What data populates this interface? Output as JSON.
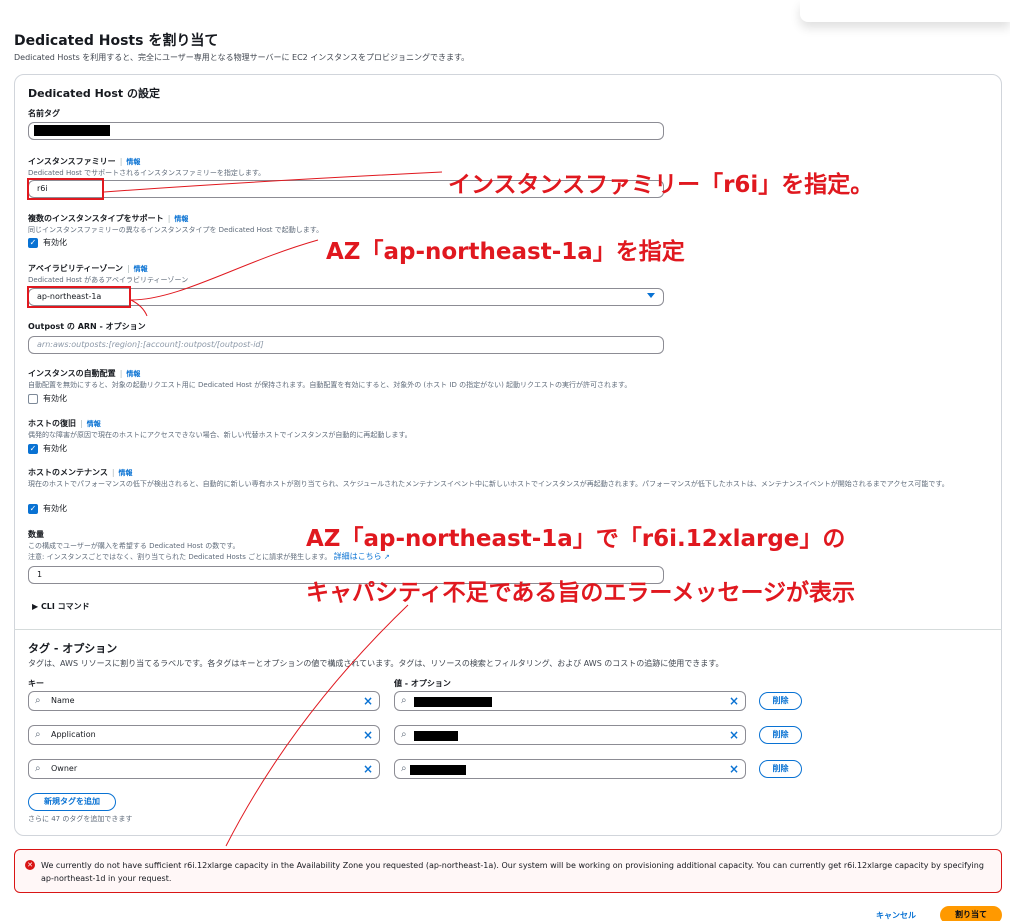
{
  "page": {
    "title": "Dedicated Hosts を割り当て",
    "description": "Dedicated Hosts を利用すると、完全にユーザー専用となる物理サーバーに EC2 インスタンスをプロビジョニングできます。"
  },
  "settings": {
    "title": "Dedicated Host の設定",
    "name_tag_label": "名前タグ",
    "info_label": "情報",
    "instance_family": {
      "label": "インスタンスファミリー",
      "desc": "Dedicated Host でサポートされるインスタンスファミリーを指定します。",
      "value": "r6i"
    },
    "multi_type": {
      "label": "複数のインスタンスタイプをサポート",
      "desc": "同じインスタンスファミリーの異なるインスタンスタイプを Dedicated Host で起動します。",
      "checkbox": "有効化",
      "checked": true
    },
    "az": {
      "label": "アベイラビリティーゾーン",
      "desc": "Dedicated Host があるアベイラビリティーゾーン",
      "value": "ap-northeast-1a"
    },
    "outpost": {
      "label": "Outpost の ARN - オプション",
      "placeholder": "arn:aws:outposts:[region]:[account]:outpost/[outpost-id]"
    },
    "auto_placement": {
      "label": "インスタンスの自動配置",
      "desc": "自動配置を無効にすると、対象の起動リクエスト用に Dedicated Host が保持されます。自動配置を有効にすると、対象外の (ホスト ID の指定がない) 起動リクエストの実行が許可されます。",
      "checkbox": "有効化",
      "checked": false
    },
    "host_recovery": {
      "label": "ホストの復旧",
      "desc": "偶発的な障害が原因で現在のホストにアクセスできない場合、新しい代替ホストでインスタンスが自動的に再起動します。",
      "checkbox": "有効化",
      "checked": true
    },
    "host_maintenance": {
      "label": "ホストのメンテナンス",
      "desc": "現在のホストでパフォーマンスの低下が検出されると、自動的に新しい専有ホストが割り当てられ、スケジュールされたメンテナンスイベント中に新しいホストでインスタンスが再起動されます。パフォーマンスが低下したホストは、メンテナンスイベントが開始されるまでアクセス可能です。",
      "checkbox": "有効化",
      "checked": true
    },
    "quantity": {
      "label": "数量",
      "desc": "この構成でユーザーが購入を希望する Dedicated Host の数です。",
      "note": "注意: インスタンスごとではなく、割り当てられた Dedicated Hosts ごとに請求が発生します。",
      "link": "詳細はこちら",
      "value": "1"
    },
    "cli": "CLI コマンド"
  },
  "tags": {
    "title": "タグ - オプション",
    "desc": "タグは、AWS リソースに割り当てるラベルです。各タグはキーとオプションの値で構成されています。タグは、リソースの検索とフィルタリング、および AWS のコストの追跡に使用できます。",
    "key_header": "キー",
    "value_header": "値 - オプション",
    "rows": [
      {
        "key": "Name",
        "remove": "削除"
      },
      {
        "key": "Application",
        "remove": "削除"
      },
      {
        "key": "Owner",
        "remove": "削除"
      }
    ],
    "add_button": "新規タグを追加",
    "remaining": "さらに 47 のタグを追加できます"
  },
  "error": {
    "message": "We currently do not have sufficient r6i.12xlarge capacity in the Availability Zone you requested (ap-northeast-1a). Our system will be working on provisioning additional capacity. You can currently get r6i.12xlarge capacity by specifying ap-northeast-1d in your request."
  },
  "footer": {
    "cancel": "キャンセル",
    "submit": "割り当て"
  },
  "annotations": {
    "family": "インスタンスファミリー「r6i」を指定。",
    "az": "AZ「ap-northeast-1a」を指定",
    "capacity_line1": "AZ「ap-northeast-1a」で「r6i.12xlarge」の",
    "capacity_line2": "キャパシティ不足である旨のエラーメッセージが表示"
  },
  "colors": {
    "annotation_red": "#e0181f",
    "link_blue": "#0972d3",
    "primary_orange": "#ff9900",
    "error_red": "#d91515"
  }
}
